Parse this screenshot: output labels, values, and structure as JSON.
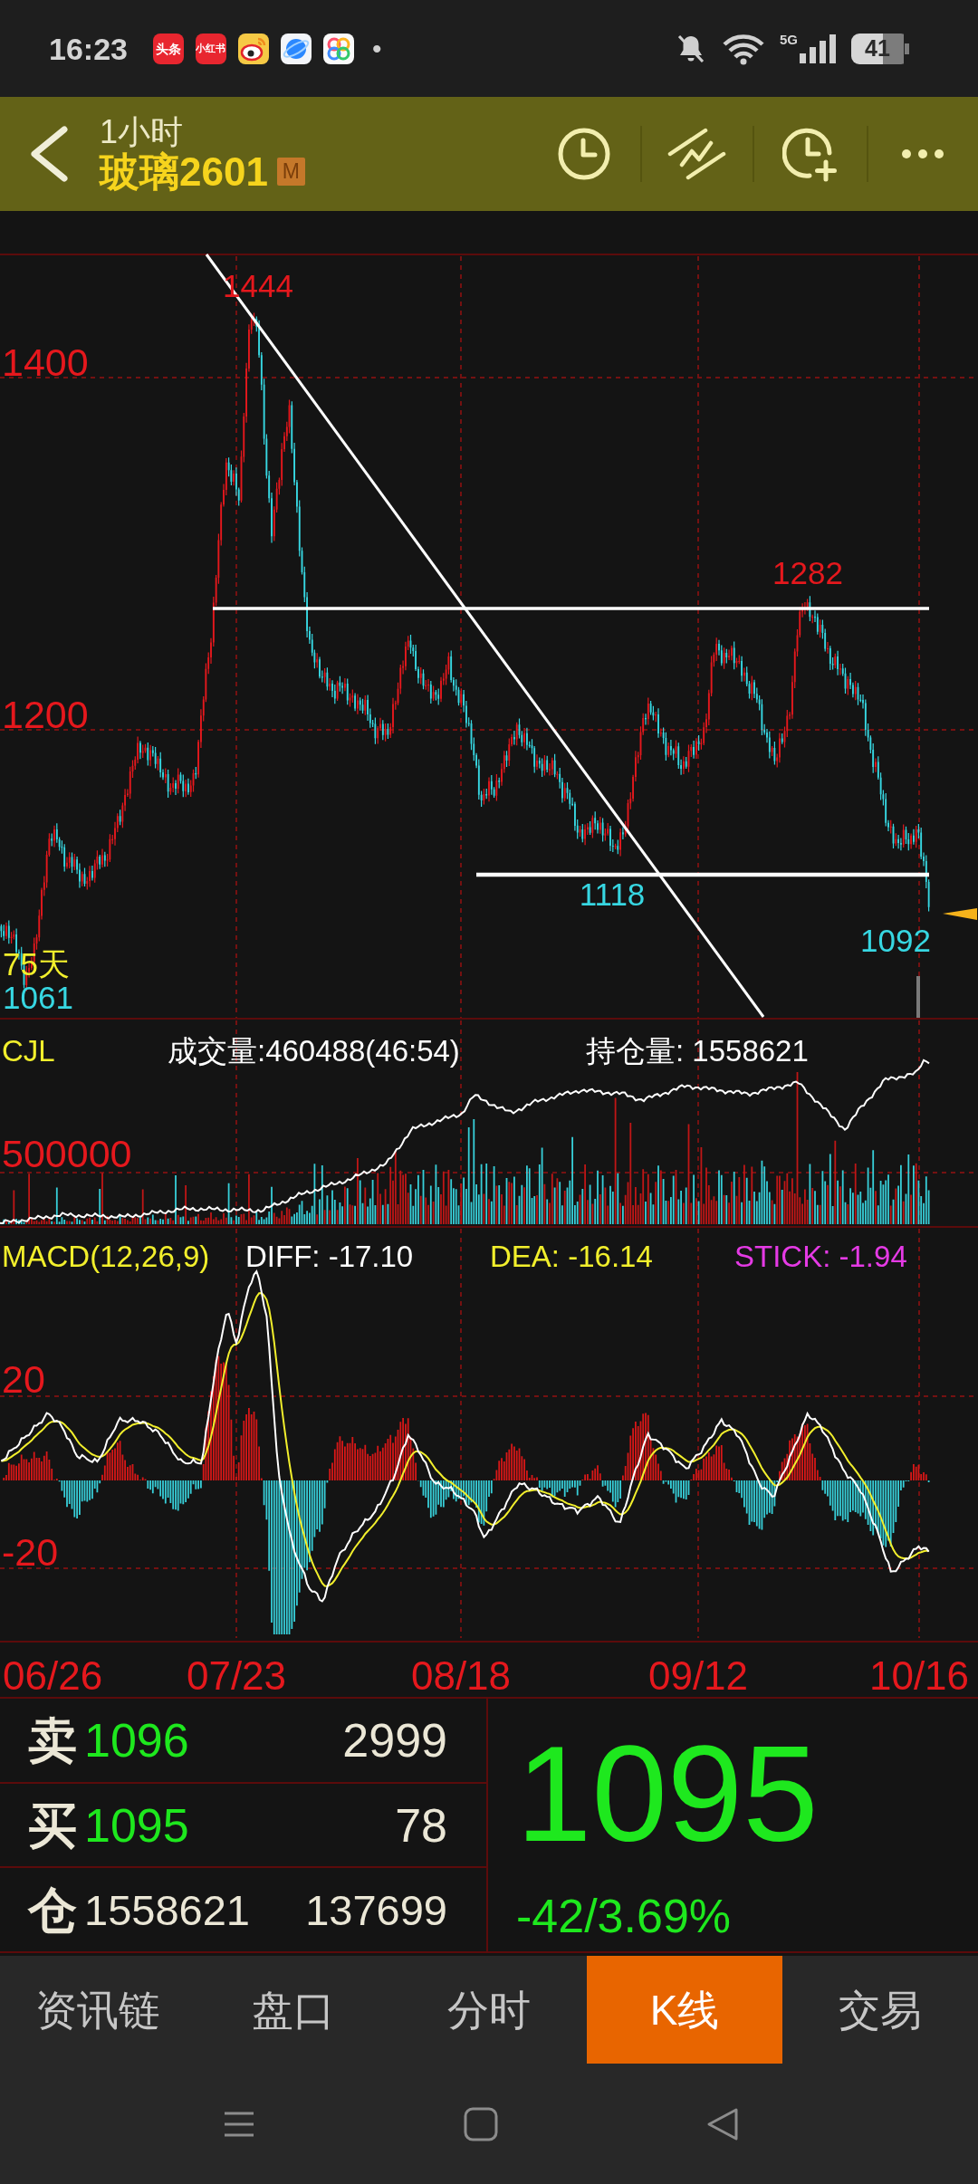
{
  "status_bar": {
    "time": "16:23",
    "notification_icons": [
      {
        "kind": "text",
        "label": "头条"
      },
      {
        "kind": "text",
        "label": "小红书"
      },
      {
        "kind": "weibo"
      },
      {
        "kind": "browser"
      },
      {
        "kind": "gallery"
      }
    ],
    "more_indicator": "•",
    "network": "5G",
    "battery": "41"
  },
  "header": {
    "period": "1小时",
    "symbol": "玻璃2601",
    "badge": "M"
  },
  "price_chart": {
    "axis_labels": [
      "1400",
      "1200"
    ],
    "extremes": [
      {
        "kind": "high",
        "value": "1444"
      },
      {
        "kind": "high",
        "value": "1282"
      },
      {
        "kind": "low",
        "value": "1118"
      },
      {
        "kind": "low",
        "value": "1092"
      },
      {
        "kind": "low",
        "value": "1061"
      }
    ],
    "period_label": "75天"
  },
  "volume_panel": {
    "title": "CJL",
    "volume": "成交量:460488(46:54)",
    "open_interest": "持仓量: 1558621",
    "axis_label": "500000"
  },
  "macd_panel": {
    "title": "MACD(12,26,9)",
    "diff": "DIFF: -17.10",
    "dea": "DEA: -16.14",
    "stick": "STICK: -1.94",
    "axis_labels": [
      "20",
      "-20"
    ]
  },
  "date_axis": [
    "06/26",
    "07/23",
    "08/18",
    "09/12",
    "10/16"
  ],
  "quote": {
    "rows": [
      {
        "kind": "order",
        "label": "卖",
        "price": "1096",
        "volume": "2999"
      },
      {
        "kind": "order",
        "label": "买",
        "price": "1095",
        "volume": "78"
      },
      {
        "kind": "position",
        "label": "仓",
        "price": "1558621",
        "volume": "137699"
      }
    ],
    "last_price": "1095",
    "change": "-42/3.69%"
  },
  "tabs": [
    {
      "label": "资讯链",
      "selected": false
    },
    {
      "label": "盘口",
      "selected": false
    },
    {
      "label": "分时",
      "selected": false
    },
    {
      "label": "K线",
      "selected": true
    },
    {
      "label": "交易",
      "selected": false
    }
  ]
}
